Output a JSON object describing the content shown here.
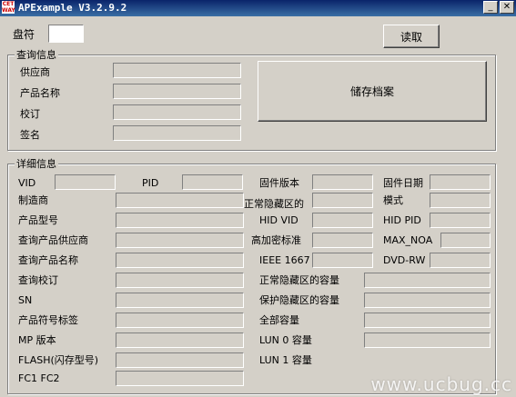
{
  "window": {
    "title": "APExample V3.2.9.2",
    "icon_text": "CET\nWAY",
    "controls": [
      "_",
      "✕"
    ]
  },
  "top": {
    "drive_label": "盘符",
    "drive_value": "",
    "read_button": "读取"
  },
  "query_group": {
    "legend": "查询信息",
    "labels": [
      "供应商",
      "产品名称",
      "校订",
      "签名"
    ],
    "save_button": "储存档案"
  },
  "detail_group": {
    "legend": "详细信息",
    "row_vid": {
      "vid": "VID",
      "pid": "PID"
    },
    "left_labels": [
      "制造商",
      "产品型号",
      "查询产品供应商",
      "查询产品名称",
      "查询校订",
      "SN",
      "产品符号标签",
      "MP 版本",
      "FLASH(闪存型号)",
      "FC1 FC2"
    ],
    "mid_labels": [
      "固件版本",
      "正常隐藏区的",
      "HID VID",
      "高加密标准",
      "IEEE 1667"
    ],
    "right_labels": [
      "固件日期",
      "模式",
      "HID PID",
      "MAX_NOA",
      "DVD-RW"
    ],
    "wide_labels": [
      "正常隐藏区的容量",
      "保护隐藏区的容量",
      "全部容量",
      "LUN 0 容量",
      "LUN 1 容量"
    ]
  },
  "watermark": "www.ucbug.cc"
}
